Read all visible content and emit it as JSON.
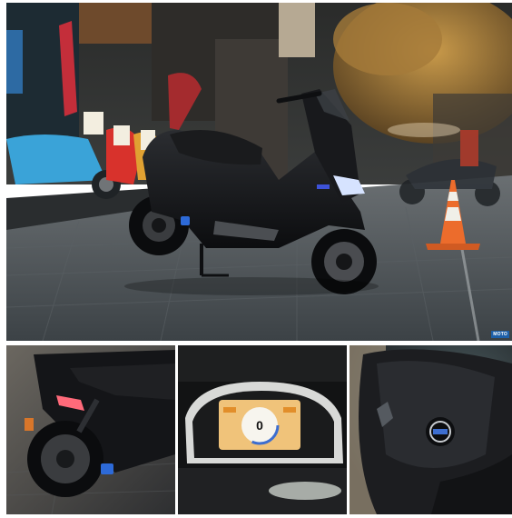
{
  "scene": {
    "description_icons": [
      "electric-scooter",
      "traffic-cone",
      "parked-scooters",
      "storefront"
    ],
    "colors": {
      "scooter_body": "#141518",
      "pavement": "#4d5358",
      "cone": "#e86a2a",
      "dash_screen": "#f0c37a",
      "tree": "#a77b37"
    }
  },
  "watermarks": {
    "hero": "MOTO",
    "p1": "",
    "p2": "",
    "p3": ""
  },
  "dashboard": {
    "speed": "0"
  }
}
